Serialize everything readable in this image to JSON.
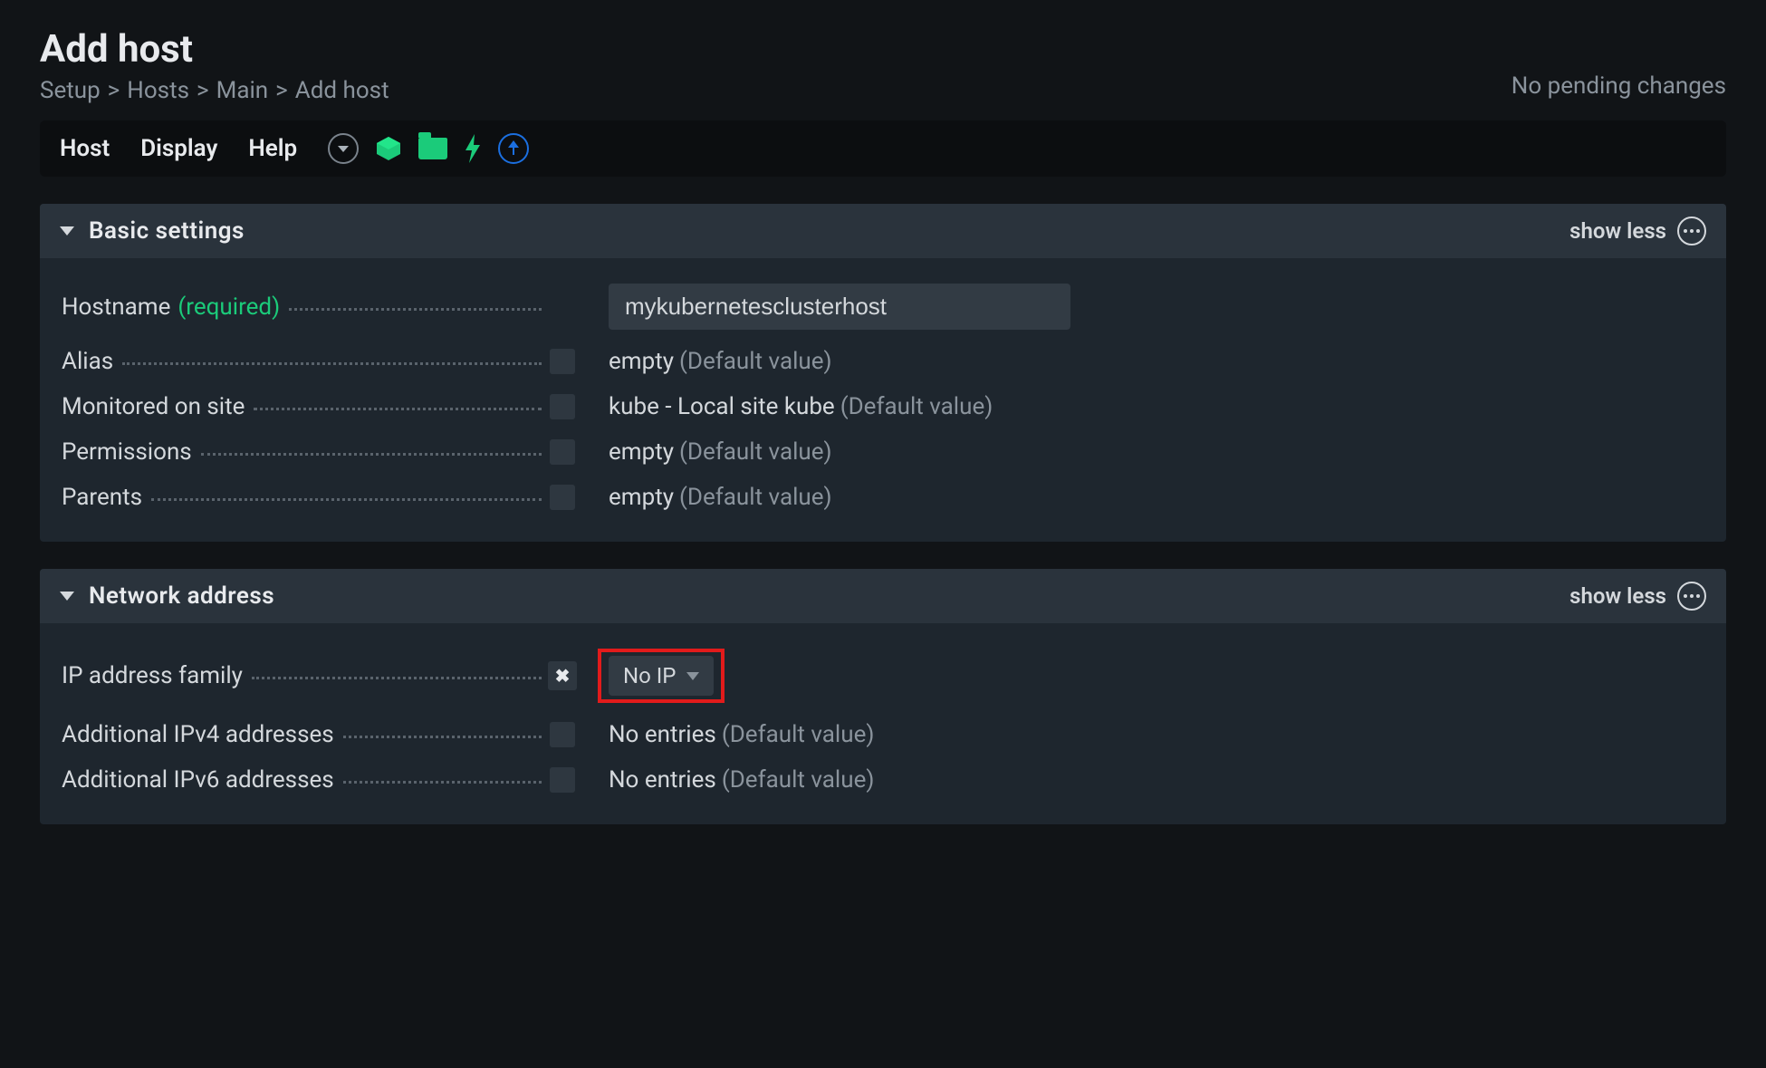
{
  "header": {
    "title": "Add host",
    "breadcrumb": [
      "Setup",
      "Hosts",
      "Main",
      "Add host"
    ],
    "pending_changes": "No pending changes"
  },
  "toolbar": {
    "items": [
      "Host",
      "Display",
      "Help"
    ]
  },
  "sections": {
    "basic": {
      "title": "Basic settings",
      "toggle": "show less",
      "fields": {
        "hostname": {
          "label": "Hostname",
          "required": "(required)",
          "value": "mykubernetesclusterhost"
        },
        "alias": {
          "label": "Alias",
          "value": "empty",
          "default": "(Default value)"
        },
        "monitored": {
          "label": "Monitored on site",
          "value": "kube - Local site kube",
          "default": "(Default value)"
        },
        "permissions": {
          "label": "Permissions",
          "value": "empty",
          "default": "(Default value)"
        },
        "parents": {
          "label": "Parents",
          "value": "empty",
          "default": "(Default value)"
        }
      }
    },
    "network": {
      "title": "Network address",
      "toggle": "show less",
      "fields": {
        "ipfamily": {
          "label": "IP address family",
          "dropdown": "No IP"
        },
        "ipv4": {
          "label": "Additional IPv4 addresses",
          "value": "No entries",
          "default": "(Default value)"
        },
        "ipv6": {
          "label": "Additional IPv6 addresses",
          "value": "No entries",
          "default": "(Default value)"
        }
      }
    }
  }
}
